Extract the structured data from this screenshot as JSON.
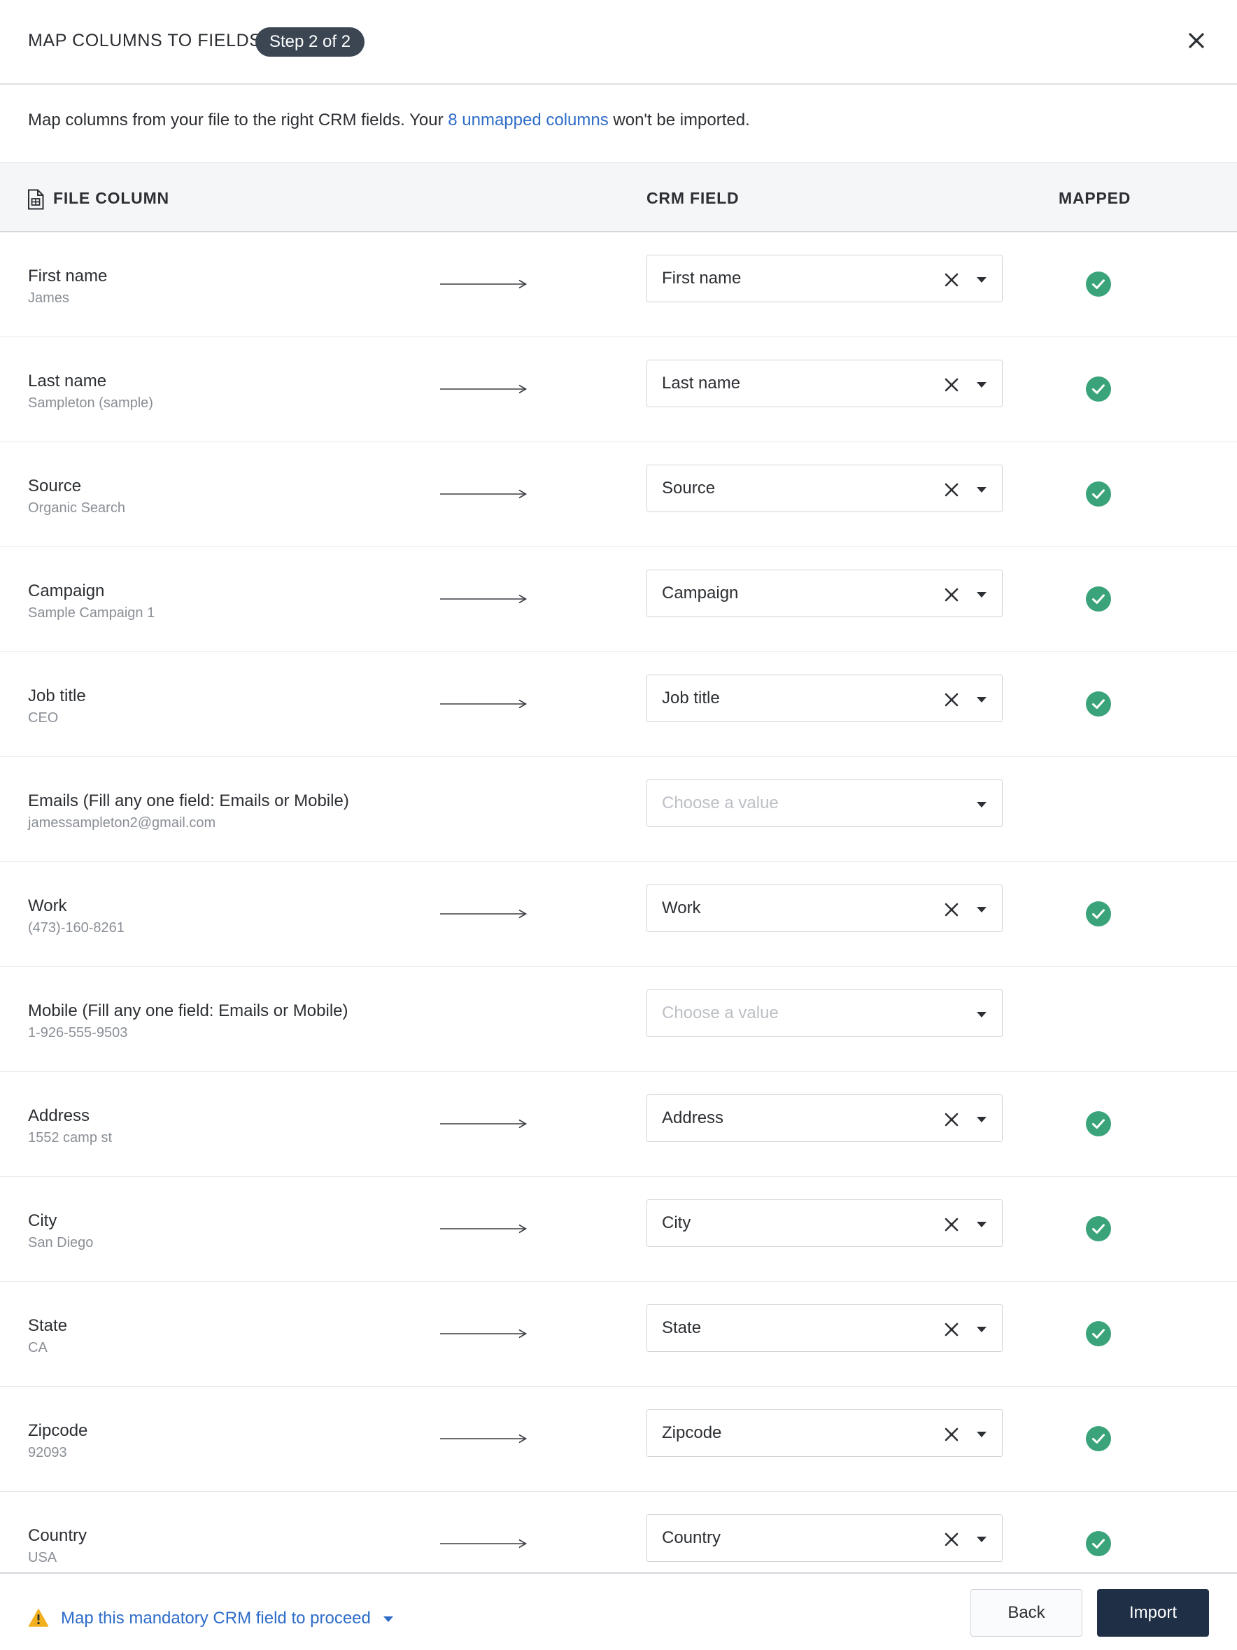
{
  "header": {
    "title": "MAP COLUMNS TO FIELDS",
    "step_badge": "Step 2 of 2",
    "close_icon": "close-icon"
  },
  "intro": {
    "prefix": "Map columns from your file to the right CRM fields. Your ",
    "link": "8 unmapped columns",
    "suffix": " won't be imported."
  },
  "table": {
    "headers": {
      "file_column": "FILE COLUMN",
      "crm_field": "CRM FIELD",
      "mapped": "MAPPED"
    },
    "placeholder": "Choose a value",
    "rows": [
      {
        "label": "First name",
        "sample": "James",
        "field": "First name",
        "mapped": true
      },
      {
        "label": "Last name",
        "sample": "Sampleton (sample)",
        "field": "Last name",
        "mapped": true
      },
      {
        "label": "Source",
        "sample": "Organic Search",
        "field": "Source",
        "mapped": true
      },
      {
        "label": "Campaign",
        "sample": "Sample Campaign 1",
        "field": "Campaign",
        "mapped": true
      },
      {
        "label": "Job title",
        "sample": "CEO",
        "field": "Job title",
        "mapped": true
      },
      {
        "label": "Emails (Fill any one field: Emails or Mobile)",
        "sample": "jamessampleton2@gmail.com",
        "field": "",
        "mapped": false
      },
      {
        "label": "Work",
        "sample": "(473)-160-8261",
        "field": "Work",
        "mapped": true
      },
      {
        "label": "Mobile (Fill any one field: Emails or Mobile)",
        "sample": "1-926-555-9503",
        "field": "",
        "mapped": false
      },
      {
        "label": "Address",
        "sample": "1552 camp st",
        "field": "Address",
        "mapped": true
      },
      {
        "label": "City",
        "sample": "San Diego",
        "field": "City",
        "mapped": true
      },
      {
        "label": "State",
        "sample": "CA",
        "field": "State",
        "mapped": true
      },
      {
        "label": "Zipcode",
        "sample": "92093",
        "field": "Zipcode",
        "mapped": true
      },
      {
        "label": "Country",
        "sample": "USA",
        "field": "Country",
        "mapped": true
      }
    ]
  },
  "footer": {
    "warning": "Map this mandatory CRM field to proceed",
    "back_label": "Back",
    "import_label": "Import"
  },
  "colors": {
    "accent_link": "#2d6cc9",
    "mapped_check": "#3aa37a",
    "primary_button": "#1f2f45",
    "warning": "#f2b01e"
  }
}
